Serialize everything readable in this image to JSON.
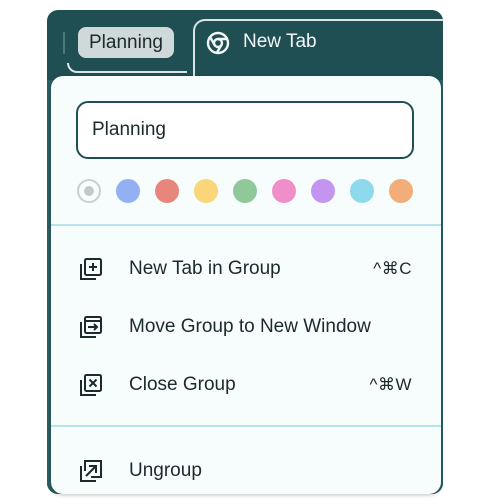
{
  "tabstrip": {
    "group_label": "Planning",
    "active_tab_title": "New Tab",
    "active_tab_icon": "chrome-icon"
  },
  "group_editor": {
    "name_value": "Planning",
    "colors": [
      {
        "name": "grey",
        "hex": "#c3c9c9",
        "selected": true
      },
      {
        "name": "blue",
        "hex": "#93b1f2"
      },
      {
        "name": "red",
        "hex": "#e8857c"
      },
      {
        "name": "yellow",
        "hex": "#f9d679"
      },
      {
        "name": "green",
        "hex": "#8fc99a"
      },
      {
        "name": "pink",
        "hex": "#ef8ec8"
      },
      {
        "name": "purple",
        "hex": "#c495f0"
      },
      {
        "name": "cyan",
        "hex": "#8fd9ec"
      },
      {
        "name": "orange",
        "hex": "#f3ad78"
      }
    ]
  },
  "menu": {
    "items": [
      {
        "label": "New Tab in Group",
        "shortcut": "^⌘C",
        "icon": "new-tab-in-group-icon"
      },
      {
        "label": "Move Group to New Window",
        "shortcut": "",
        "icon": "move-to-window-icon"
      },
      {
        "label": "Close Group",
        "shortcut": "^⌘W",
        "icon": "close-group-icon"
      },
      {
        "label": "Ungroup",
        "shortcut": "",
        "icon": "ungroup-icon"
      }
    ]
  },
  "colors": {
    "frame": "#1f4f53",
    "menu_bg": "#f7fcfc",
    "divider": "#b7e4ea",
    "text": "#1b2a2c"
  }
}
